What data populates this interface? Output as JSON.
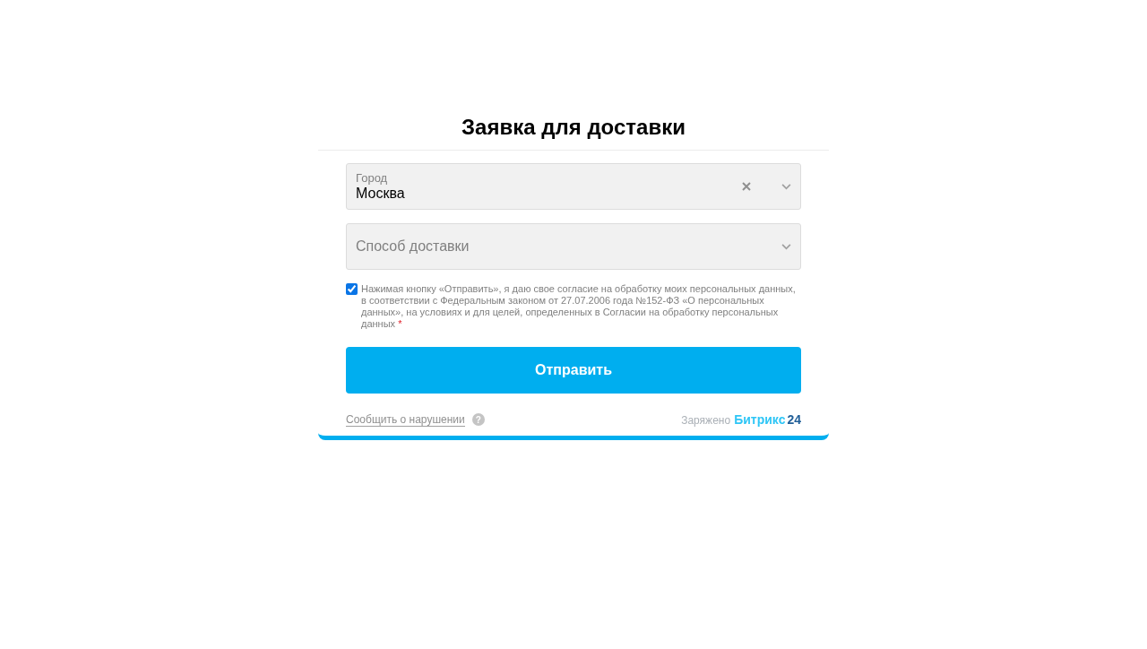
{
  "form": {
    "title": "Заявка для доставки",
    "fields": [
      {
        "kind": "select",
        "label": "Город",
        "value": "Москва",
        "clearable": true
      },
      {
        "kind": "select",
        "placeholder": "Способ доставки",
        "clearable": false
      }
    ],
    "consent": {
      "checked": true,
      "text": "Нажимая кнопку «Отправить», я даю свое согласие на обработку моих персональных данных, в соответствии с Федеральным законом от 27.07.2006 года №152-ФЗ «О персональных данных», на условиях и для целей, определенных в Согласии на обработку персональных данных",
      "required": true,
      "required_mark": "*"
    },
    "submit": "Отправить",
    "footer": {
      "report_link": "Сообщить о нарушении",
      "help": "?",
      "powered_by": "Заряжено",
      "brand": "Битрикс",
      "brand_number": "24"
    }
  }
}
